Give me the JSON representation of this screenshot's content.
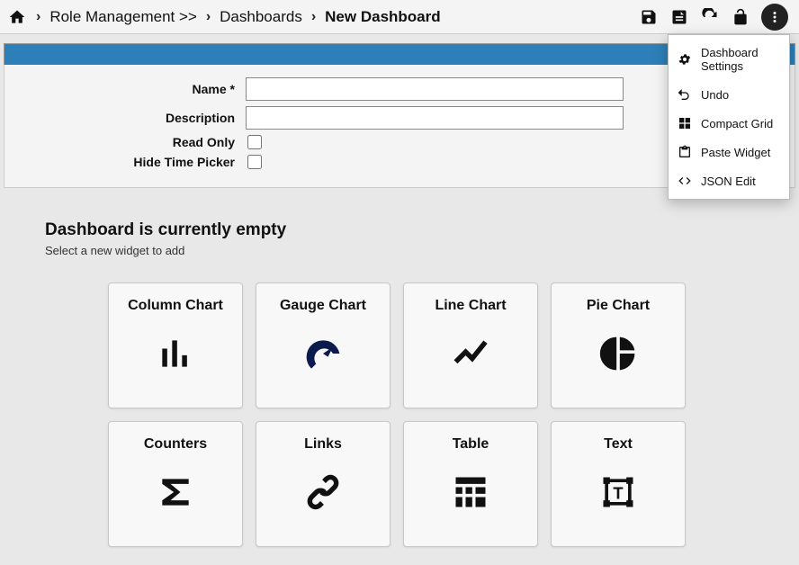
{
  "breadcrumb": {
    "parent": "Role Management >>",
    "section": "Dashboards",
    "current": "New Dashboard"
  },
  "form": {
    "name_label": "Name *",
    "name_value": "",
    "desc_label": "Description",
    "desc_value": "",
    "readonly_label": "Read Only",
    "hidetp_label": "Hide Time Picker"
  },
  "empty": {
    "title": "Dashboard is currently empty",
    "subtitle": "Select a new widget to add"
  },
  "widgets": {
    "column": "Column Chart",
    "gauge": "Gauge Chart",
    "line": "Line Chart",
    "pie": "Pie Chart",
    "counters": "Counters",
    "links": "Links",
    "table": "Table",
    "text": "Text"
  },
  "menu": {
    "settings": "Dashboard Settings",
    "undo": "Undo",
    "compact": "Compact Grid",
    "paste": "Paste Widget",
    "json": "JSON Edit"
  }
}
